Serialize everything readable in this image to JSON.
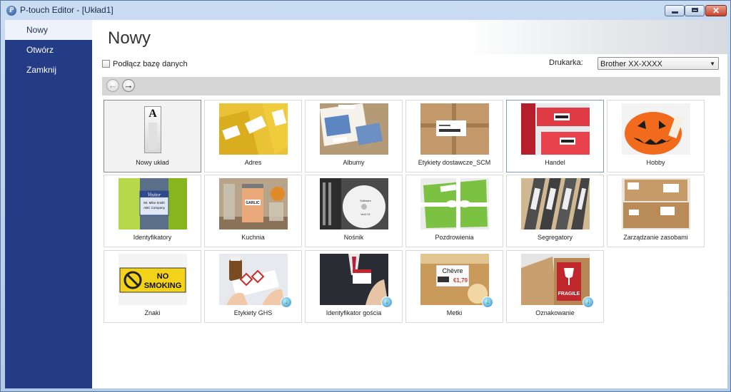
{
  "window": {
    "title": "P-touch Editor - [Układ1]",
    "app_icon_glyph": "P"
  },
  "sidebar": {
    "items": [
      {
        "label": "Nowy"
      },
      {
        "label": "Otwórz"
      },
      {
        "label": "Zamknij"
      }
    ]
  },
  "main": {
    "title": "Nowy",
    "connect_db_label": "Podłącz bazę danych",
    "printer_label": "Drukarka:",
    "printer_value": "Brother XX-XXXX"
  },
  "tiles": [
    {
      "label": "Nowy układ"
    },
    {
      "label": "Adres"
    },
    {
      "label": "Albumy"
    },
    {
      "label": "Etykiety dostawcze_SCM"
    },
    {
      "label": "Handel"
    },
    {
      "label": "Hobby"
    },
    {
      "label": "Identyfikatory"
    },
    {
      "label": "Kuchnia"
    },
    {
      "label": "Nośnik"
    },
    {
      "label": "Pozdrowienia"
    },
    {
      "label": "Segregatory"
    },
    {
      "label": "Zarządzanie zasobami"
    },
    {
      "label": "Znaki"
    },
    {
      "label": "Etykiety GHS"
    },
    {
      "label": "Identyfikator gościa"
    },
    {
      "label": "Metki"
    },
    {
      "label": "Oznakowanie"
    }
  ],
  "thumb_text": {
    "new_layout": "A",
    "visitor_badge": "Visitor",
    "visitor_name": "Mr. Mike Smith",
    "visitor_company": "ABC Company",
    "garlic": "GARLIC",
    "disc_line1": "Software",
    "disc_line2": "Ver2.01",
    "sign_line1": "NO",
    "sign_line2": "SMOKING",
    "chevre": "Chèvre",
    "price": "€1,79",
    "fragile": "FRAGILE"
  },
  "colors": {
    "sidebar": "#243b86",
    "sign_yellow": "#f3d21a",
    "price_red": "#d23a2e",
    "fragile_red": "#c0292b"
  }
}
